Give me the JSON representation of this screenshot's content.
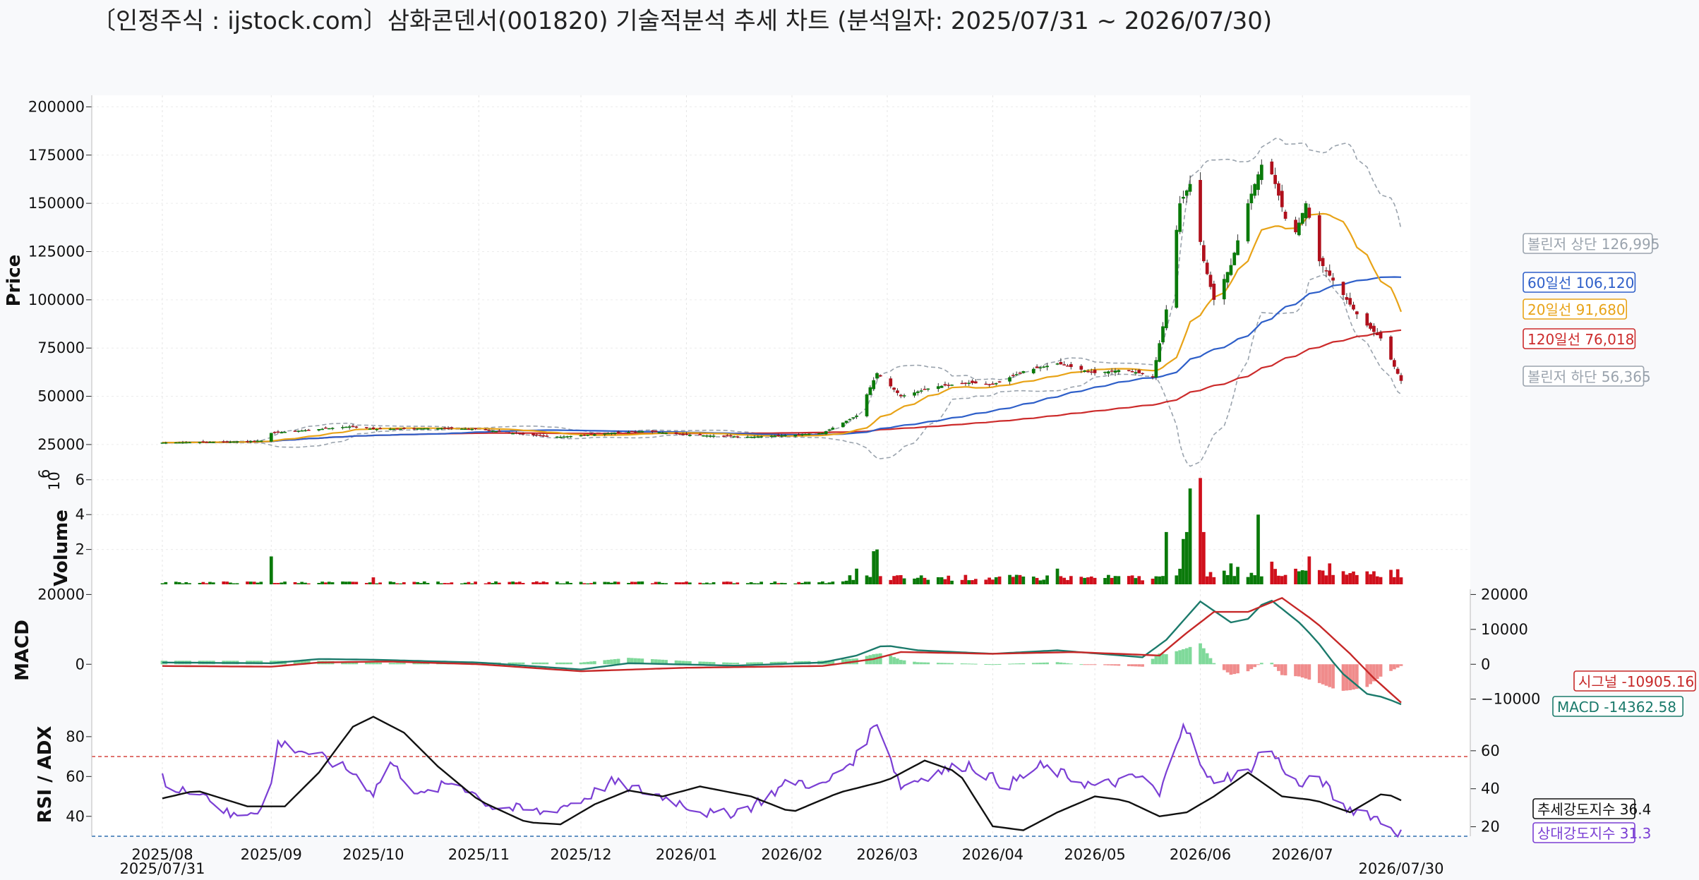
{
  "chart_data": {
    "type": "candlestick",
    "title": "〔인정주식 : ijstock.com〕삼화콘덴서(001820) 기술적분석 추세 차트 (분석일자: 2025/07/31 ~ 2026/07/30)",
    "start_date": "2025/07/31",
    "end_date": "2026/07/30",
    "x_ticks": [
      "2025/08",
      "2025/09",
      "2025/10",
      "2025/11",
      "2025/12",
      "2026/01",
      "2026/02",
      "2026/03",
      "2026/04",
      "2026/05",
      "2026/06",
      "2026/07"
    ],
    "price_panel": {
      "ylabel": "Price",
      "yticks": [
        25000,
        50000,
        75000,
        100000,
        125000,
        150000,
        175000,
        200000
      ],
      "ylim": [
        14000,
        206000
      ],
      "close_keypoints": [
        [
          "2025/07/31",
          26000
        ],
        [
          "2025/08/20",
          26500
        ],
        [
          "2025/08/29",
          27000
        ],
        [
          "2025/09/01",
          31000
        ],
        [
          "2025/09/15",
          33000
        ],
        [
          "2025/09/25",
          34500
        ],
        [
          "2025/10/01",
          33000
        ],
        [
          "2025/10/20",
          33500
        ],
        [
          "2025/11/01",
          33000
        ],
        [
          "2025/11/15",
          30000
        ],
        [
          "2025/11/25",
          29000
        ],
        [
          "2025/12/10",
          31000
        ],
        [
          "2025/12/20",
          32000
        ],
        [
          "2026/01/01",
          30000
        ],
        [
          "2026/01/20",
          29000
        ],
        [
          "2026/02/01",
          30000
        ],
        [
          "2026/02/10",
          31000
        ],
        [
          "2026/02/20",
          40000
        ],
        [
          "2026/02/26",
          62000
        ],
        [
          "2026/03/05",
          50000
        ],
        [
          "2026/03/15",
          55000
        ],
        [
          "2026/03/25",
          57000
        ],
        [
          "2026/04/01",
          56000
        ],
        [
          "2026/04/10",
          63000
        ],
        [
          "2026/04/20",
          67000
        ],
        [
          "2026/05/01",
          62000
        ],
        [
          "2026/05/10",
          64000
        ],
        [
          "2026/05/18",
          60000
        ],
        [
          "2026/05/22",
          95000
        ],
        [
          "2026/05/26",
          150000
        ],
        [
          "2026/05/29",
          160000
        ],
        [
          "2026/06/02",
          120000
        ],
        [
          "2026/06/05",
          100000
        ],
        [
          "2026/06/10",
          118000
        ],
        [
          "2026/06/15",
          150000
        ],
        [
          "2026/06/20",
          175000
        ],
        [
          "2026/06/23",
          160000
        ],
        [
          "2026/06/28",
          130000
        ],
        [
          "2026/07/02",
          150000
        ],
        [
          "2026/07/06",
          120000
        ],
        [
          "2026/07/12",
          105000
        ],
        [
          "2026/07/18",
          90000
        ],
        [
          "2026/07/24",
          80000
        ],
        [
          "2026/07/30",
          58000
        ]
      ],
      "series": [
        {
          "name": "볼린저 상단",
          "last": 126995,
          "color": "#9aa3ad",
          "label": "볼린저 상단 126,995"
        },
        {
          "name": "60일선",
          "last": 106120,
          "color": "#2e5fc9",
          "label": "60일선 106,120"
        },
        {
          "name": "20일선",
          "last": 91680,
          "color": "#e8a317",
          "label": "20일선 91,680"
        },
        {
          "name": "120일선",
          "last": 76018,
          "color": "#cc2b2b",
          "label": "120일선 76,018"
        },
        {
          "name": "볼린저 하단",
          "last": 56365,
          "color": "#9aa3ad",
          "label": "볼린저 하단 56,365"
        }
      ]
    },
    "volume_panel": {
      "ylabel": "Volume",
      "exponent": "10",
      "exponent_power": "6",
      "yticks": [
        2,
        4,
        6
      ],
      "ylim": [
        0,
        6.6
      ],
      "spikes": [
        [
          "2025/09/01",
          1.6
        ],
        [
          "2025/10/01",
          0.4
        ],
        [
          "2025/12/21",
          0.3
        ],
        [
          "2026/02/20",
          0.9
        ],
        [
          "2026/02/25",
          1.9
        ],
        [
          "2026/02/26",
          2.0
        ],
        [
          "2026/03/01",
          0.7
        ],
        [
          "2026/04/20",
          0.9
        ],
        [
          "2026/05/22",
          3.0
        ],
        [
          "2026/05/27",
          2.6
        ],
        [
          "2026/05/28",
          3.0
        ],
        [
          "2026/05/29",
          5.5
        ],
        [
          "2026/06/01",
          6.1
        ],
        [
          "2026/06/02",
          3.0
        ],
        [
          "2026/06/10",
          1.2
        ],
        [
          "2026/06/12",
          1.0
        ],
        [
          "2026/06/18",
          4.0
        ],
        [
          "2026/06/22",
          1.3
        ],
        [
          "2026/07/03",
          1.6
        ],
        [
          "2026/07/09",
          1.2
        ]
      ]
    },
    "macd_panel": {
      "ylabel": "MACD",
      "left_yticks": [
        0,
        20000
      ],
      "right_yticks": [
        -10000,
        0,
        10000,
        20000
      ],
      "ylim": [
        -13500,
        21500
      ],
      "macd_keypoints": [
        [
          "2025/07/31",
          500
        ],
        [
          "2025/09/01",
          300
        ],
        [
          "2025/09/15",
          1500
        ],
        [
          "2025/10/01",
          1300
        ],
        [
          "2025/11/01",
          500
        ],
        [
          "2025/12/01",
          -1500
        ],
        [
          "2025/12/15",
          300
        ],
        [
          "2026/01/15",
          -400
        ],
        [
          "2026/02/10",
          500
        ],
        [
          "2026/02/20",
          2500
        ],
        [
          "2026/02/28",
          5500
        ],
        [
          "2026/03/10",
          4000
        ],
        [
          "2026/04/01",
          3000
        ],
        [
          "2026/04/20",
          4000
        ],
        [
          "2026/05/15",
          2000
        ],
        [
          "2026/05/22",
          7000
        ],
        [
          "2026/06/01",
          18000
        ],
        [
          "2026/06/10",
          12000
        ],
        [
          "2026/06/15",
          13000
        ],
        [
          "2026/06/21",
          19000
        ],
        [
          "2026/06/30",
          12000
        ],
        [
          "2026/07/05",
          7000
        ],
        [
          "2026/07/12",
          -2000
        ],
        [
          "2026/07/20",
          -8500
        ],
        [
          "2026/07/25",
          -9500
        ],
        [
          "2026/07/30",
          -11500
        ]
      ],
      "signal_keypoints": [
        [
          "2025/07/31",
          -500
        ],
        [
          "2025/09/01",
          -700
        ],
        [
          "2025/09/15",
          500
        ],
        [
          "2025/10/05",
          800
        ],
        [
          "2025/11/01",
          0
        ],
        [
          "2025/12/01",
          -2000
        ],
        [
          "2026/01/01",
          -1000
        ],
        [
          "2026/02/10",
          -500
        ],
        [
          "2026/02/25",
          1500
        ],
        [
          "2026/03/05",
          3500
        ],
        [
          "2026/04/01",
          3000
        ],
        [
          "2026/04/25",
          3500
        ],
        [
          "2026/05/20",
          2500
        ],
        [
          "2026/05/28",
          9000
        ],
        [
          "2026/06/05",
          15000
        ],
        [
          "2026/06/15",
          15000
        ],
        [
          "2026/06/25",
          19000
        ],
        [
          "2026/07/05",
          12000
        ],
        [
          "2026/07/15",
          3000
        ],
        [
          "2026/07/22",
          -4000
        ],
        [
          "2026/07/30",
          -11000
        ]
      ],
      "series": [
        {
          "name": "시그널",
          "last": -10905.16,
          "color": "#c62828",
          "label": "시그널 -10905.16"
        },
        {
          "name": "MACD",
          "last": -14362.58,
          "color": "#1b7a6b",
          "label": "MACD -14362.58"
        }
      ]
    },
    "rsi_adx_panel": {
      "ylabel": "RSI / ADX",
      "left_yticks": [
        40,
        60,
        80
      ],
      "right_yticks": [
        20,
        40,
        60
      ],
      "ylim": [
        30,
        92
      ],
      "reference_lines": [
        70,
        30
      ],
      "rsi_keypoints": [
        [
          "2025/07/31",
          62
        ],
        [
          "2025/08/02",
          50
        ],
        [
          "2025/08/10",
          55
        ],
        [
          "2025/08/20",
          40
        ],
        [
          "2025/08/31",
          45
        ],
        [
          "2025/09/03",
          77
        ],
        [
          "2025/09/15",
          70
        ],
        [
          "2025/09/25",
          62
        ],
        [
          "2025/10/01",
          52
        ],
        [
          "2025/10/06",
          67
        ],
        [
          "2025/10/15",
          50
        ],
        [
          "2025/10/25",
          58
        ],
        [
          "2025/11/05",
          45
        ],
        [
          "2025/11/20",
          42
        ],
        [
          "2025/12/01",
          48
        ],
        [
          "2025/12/10",
          57
        ],
        [
          "2025/12/25",
          50
        ],
        [
          "2026/01/10",
          40
        ],
        [
          "2026/01/20",
          45
        ],
        [
          "2026/02/01",
          58
        ],
        [
          "2026/02/10",
          55
        ],
        [
          "2026/02/20",
          70
        ],
        [
          "2026/02/26",
          88
        ],
        [
          "2026/03/05",
          55
        ],
        [
          "2026/03/15",
          62
        ],
        [
          "2026/03/25",
          66
        ],
        [
          "2026/04/05",
          55
        ],
        [
          "2026/04/15",
          65
        ],
        [
          "2026/05/01",
          55
        ],
        [
          "2026/05/15",
          60
        ],
        [
          "2026/05/20",
          50
        ],
        [
          "2026/05/27",
          88
        ],
        [
          "2026/06/03",
          58
        ],
        [
          "2026/06/15",
          62
        ],
        [
          "2026/06/20",
          76
        ],
        [
          "2026/06/30",
          55
        ],
        [
          "2026/07/06",
          60
        ],
        [
          "2026/07/12",
          45
        ],
        [
          "2026/07/20",
          42
        ],
        [
          "2026/07/30",
          31.3
        ]
      ],
      "adx_keypoints": [
        [
          "2025/07/31",
          49
        ],
        [
          "2025/08/10",
          53
        ],
        [
          "2025/08/25",
          45
        ],
        [
          "2025/09/05",
          45
        ],
        [
          "2025/09/15",
          62
        ],
        [
          "2025/09/25",
          85
        ],
        [
          "2025/10/01",
          90
        ],
        [
          "2025/10/10",
          82
        ],
        [
          "2025/10/20",
          65
        ],
        [
          "2025/11/01",
          48
        ],
        [
          "2025/11/15",
          37
        ],
        [
          "2025/11/25",
          36
        ],
        [
          "2025/12/05",
          46
        ],
        [
          "2025/12/15",
          53
        ],
        [
          "2025/12/25",
          50
        ],
        [
          "2026/01/05",
          55
        ],
        [
          "2026/01/20",
          50
        ],
        [
          "2026/02/01",
          42
        ],
        [
          "2026/02/15",
          52
        ],
        [
          "2026/03/01",
          58
        ],
        [
          "2026/03/12",
          68
        ],
        [
          "2026/03/22",
          62
        ],
        [
          "2026/04/01",
          35
        ],
        [
          "2026/04/10",
          33
        ],
        [
          "2026/04/20",
          42
        ],
        [
          "2026/05/01",
          50
        ],
        [
          "2026/05/10",
          48
        ],
        [
          "2026/05/20",
          40
        ],
        [
          "2026/05/28",
          42
        ],
        [
          "2026/06/05",
          50
        ],
        [
          "2026/06/15",
          62
        ],
        [
          "2026/06/25",
          50
        ],
        [
          "2026/07/05",
          48
        ],
        [
          "2026/07/15",
          42
        ],
        [
          "2026/07/25",
          52
        ],
        [
          "2026/07/30",
          48
        ]
      ],
      "series": [
        {
          "name": "추세강도지수",
          "last": 36.4,
          "color": "#111111",
          "label": "추세강도지수 36.4"
        },
        {
          "name": "상대강도지수",
          "last": 31.3,
          "color": "#7b3fd4",
          "label": "상대강도지수 31.3"
        }
      ]
    }
  }
}
